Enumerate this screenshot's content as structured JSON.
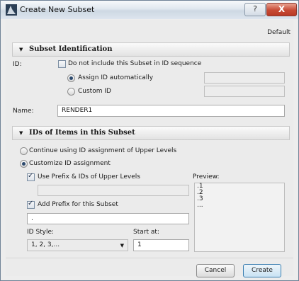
{
  "window": {
    "title": "Create New Subset",
    "help_glyph": "?",
    "close_glyph": "X"
  },
  "header": {
    "default_label": "Default"
  },
  "identification": {
    "section_title": "Subset Identification",
    "id_label": "ID:",
    "exclude_label": "Do not include this Subset in ID sequence",
    "exclude_checked": false,
    "assign_auto_label": "Assign ID automatically",
    "custom_id_label": "Custom ID",
    "id_mode": "auto",
    "auto_id_value": "",
    "custom_id_value": "",
    "name_label": "Name:",
    "name_value": "RENDER1"
  },
  "ids": {
    "section_title": "IDs of Items in this Subset",
    "continue_label": "Continue using ID assignment of Upper Levels",
    "customize_label": "Customize ID assignment",
    "mode": "customize",
    "use_prefix_label": "Use Prefix & IDs of Upper Levels",
    "use_prefix_checked": true,
    "upper_prefix_value": "",
    "add_prefix_label": "Add Prefix for this Subset",
    "add_prefix_checked": true,
    "prefix_value": ".",
    "id_style_label": "ID Style:",
    "id_style_value": "1, 2, 3,...",
    "start_at_label": "Start at:",
    "start_at_value": "1",
    "preview_label": "Preview:",
    "preview_lines": [
      ".1",
      ".2",
      ".3",
      "..."
    ]
  },
  "footer": {
    "cancel_label": "Cancel",
    "create_label": "Create"
  },
  "colors": {
    "titlebar": "#dfe7ef",
    "close_button": "#c74a35",
    "primary_button_border": "#3c7fb1"
  }
}
